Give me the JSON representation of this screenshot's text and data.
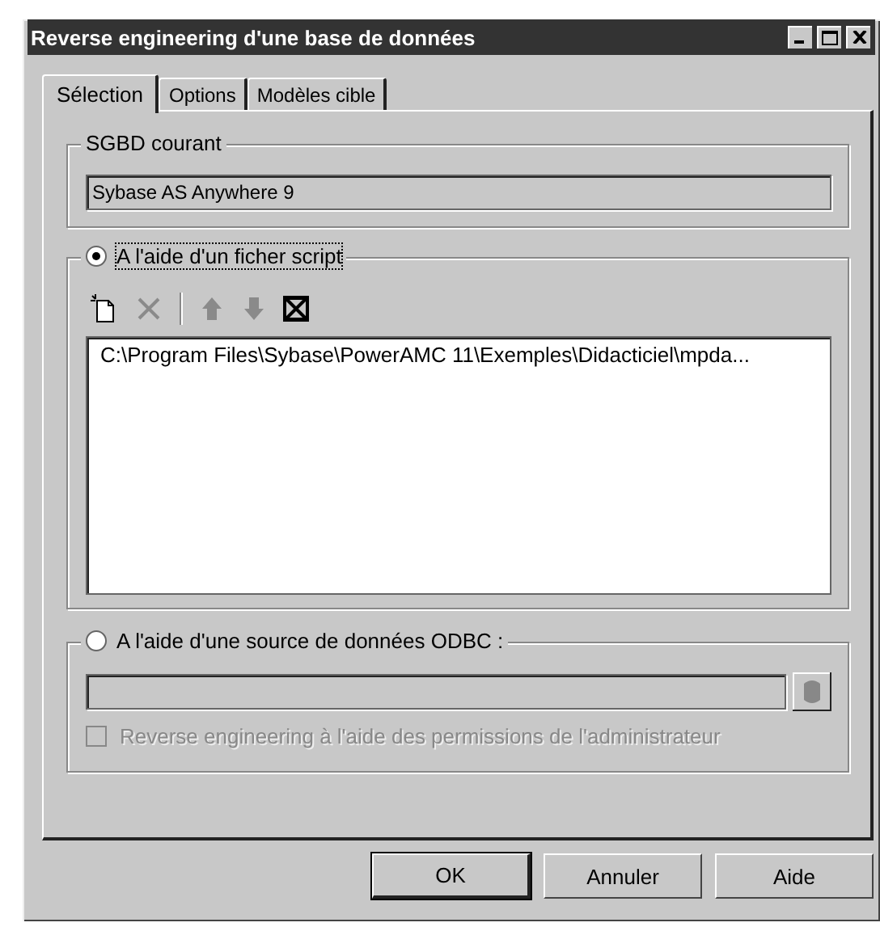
{
  "window": {
    "title": "Reverse engineering d'une base de données"
  },
  "tabs": [
    {
      "label": "Sélection",
      "selected": true
    },
    {
      "label": "Options",
      "selected": false
    },
    {
      "label": "Modèles cible",
      "selected": false
    }
  ],
  "current_dbms": {
    "label": "SGBD courant",
    "value": "Sybase AS Anywhere 9"
  },
  "sources": [
    {
      "kind": "script",
      "label": "A l'aide d'un ficher script",
      "selected": true,
      "toolbar": [
        {
          "kind": "new",
          "disabled": false
        },
        {
          "kind": "delete",
          "disabled": true
        },
        {
          "kind": "separator"
        },
        {
          "kind": "up",
          "disabled": true
        },
        {
          "kind": "down",
          "disabled": true
        },
        {
          "kind": "clear",
          "disabled": false
        }
      ],
      "files": [
        "C:\\Program Files\\Sybase\\PowerAMC 11\\Exemples\\Didacticiel\\mpda..."
      ]
    },
    {
      "kind": "odbc",
      "label": "A l'aide d'une source de données ODBC :",
      "selected": false,
      "disabled": true,
      "checkbox": {
        "label": "Reverse engineering à l'aide des permissions de l'administrateur",
        "checked": false,
        "disabled": true
      }
    }
  ],
  "buttons": [
    {
      "label": "OK",
      "default": true
    },
    {
      "label": "Annuler",
      "default": false
    },
    {
      "label": "Aide",
      "default": false
    }
  ]
}
